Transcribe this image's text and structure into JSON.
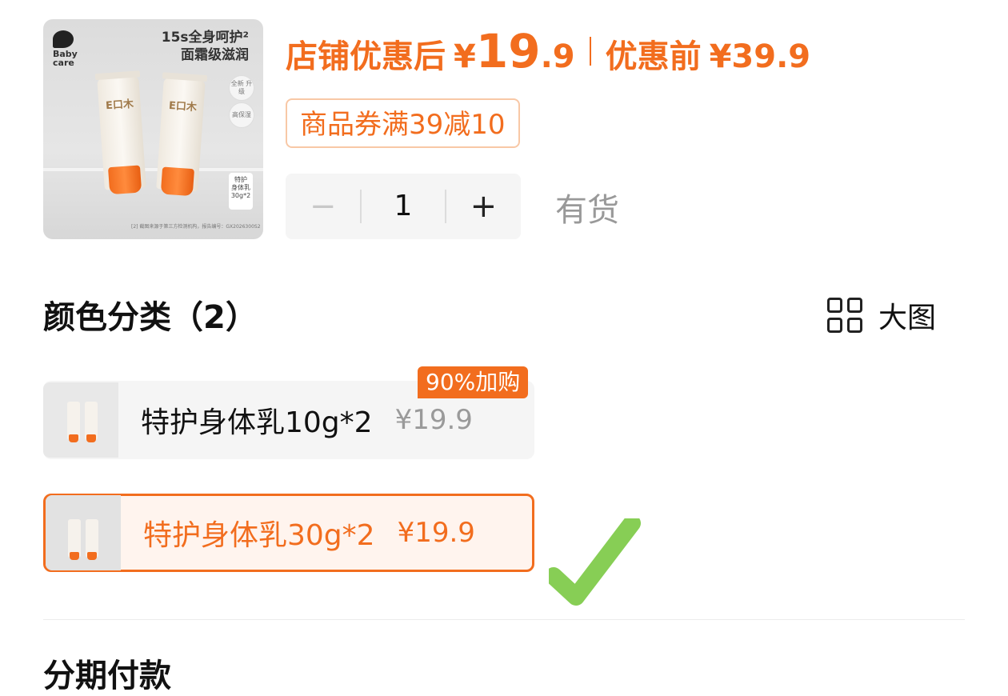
{
  "thumbnail": {
    "brand": "Baby\ncare",
    "headline": "15s全身呵护²\n面霜级滋润",
    "tube_label": "E口木",
    "badges": [
      "全新\n升级",
      "高保湿"
    ],
    "spec": "特护\n身体乳\n30g*2",
    "footnote": "[2] 截图来源于第三方检测机构，报告编号：GX2026300S2"
  },
  "price": {
    "after_label": "店铺优惠后",
    "currency": "¥",
    "after_int": "19",
    "after_dec": ".9",
    "before_label": "优惠前",
    "before_value": "¥39.9"
  },
  "coupon": "商品券满39减10",
  "stepper": {
    "minus": "−",
    "quantity": "1",
    "plus": "+"
  },
  "stock_status": "有货",
  "section": {
    "title": "颜色分类（2）",
    "view_label": "大图"
  },
  "options": [
    {
      "name": "特护身体乳10g*2",
      "price": "¥19.9",
      "tag": "90%加购",
      "selected": false
    },
    {
      "name": "特护身体乳30g*2",
      "price": "¥19.9",
      "selected": true
    }
  ],
  "next_section_title": "分期付款",
  "colors": {
    "accent": "#f26d1e",
    "check": "#7ac943"
  }
}
